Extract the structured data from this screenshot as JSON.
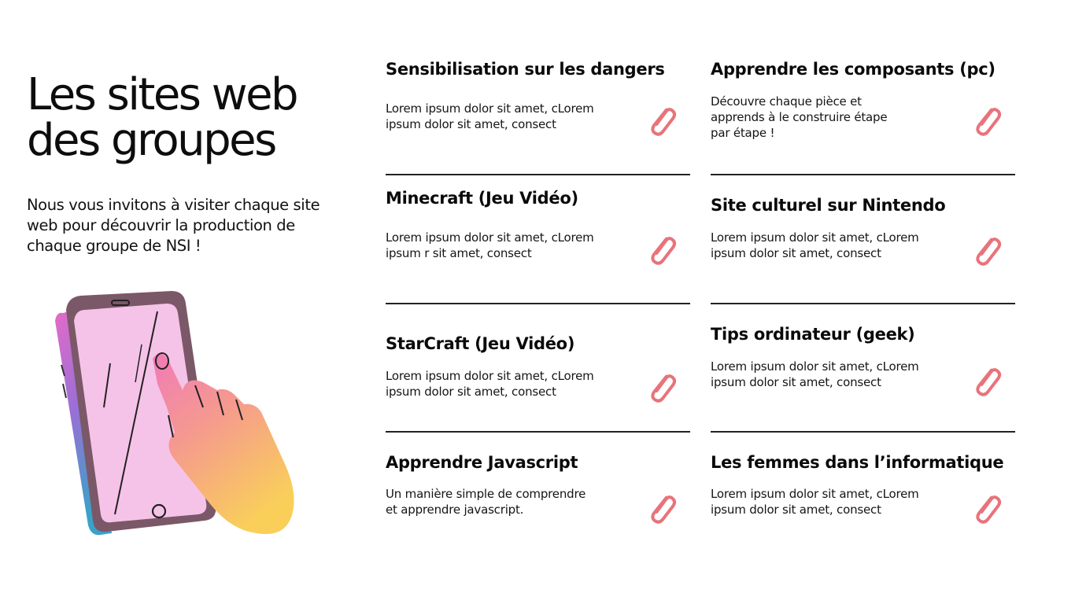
{
  "title_line1": "Les sites web",
  "title_line2": "des groupes",
  "intro": "Nous vous invitons à visiter chaque site web pour découvrir la production de chaque groupe de NSI !",
  "icon": "paperclip-icon",
  "colors": {
    "accent": "#e8737b",
    "text": "#111111",
    "divider": "#222222"
  },
  "cards": [
    {
      "title": "Sensibilisation sur les dangers",
      "desc": "Lorem ipsum dolor sit amet, cLorem\nipsum dolor sit amet, consect"
    },
    {
      "title": "Apprendre les composants (pc)",
      "desc": "Découvre chaque pièce et\napprends à le construire étape\npar étape !"
    },
    {
      "title": "Minecraft (Jeu Vidéo)",
      "desc": "Lorem ipsum dolor sit amet, cLorem\nipsum r sit amet, consect"
    },
    {
      "title": "Site culturel sur Nintendo",
      "desc": "Lorem ipsum dolor sit amet, cLorem\nipsum dolor sit amet, consect"
    },
    {
      "title": "StarCraft (Jeu Vidéo)",
      "desc": "Lorem ipsum dolor sit amet, cLorem\nipsum dolor sit amet, consect"
    },
    {
      "title": "Tips ordinateur (geek)",
      "desc": "Lorem ipsum dolor sit amet, cLorem\nipsum dolor sit amet, consect"
    },
    {
      "title": "Apprendre Javascript",
      "desc": "Un manière simple de comprendre\net apprendre javascript."
    },
    {
      "title": "Les femmes dans l’informatique",
      "desc": "Lorem ipsum dolor sit amet, cLorem\nipsum dolor sit amet, consect"
    }
  ]
}
